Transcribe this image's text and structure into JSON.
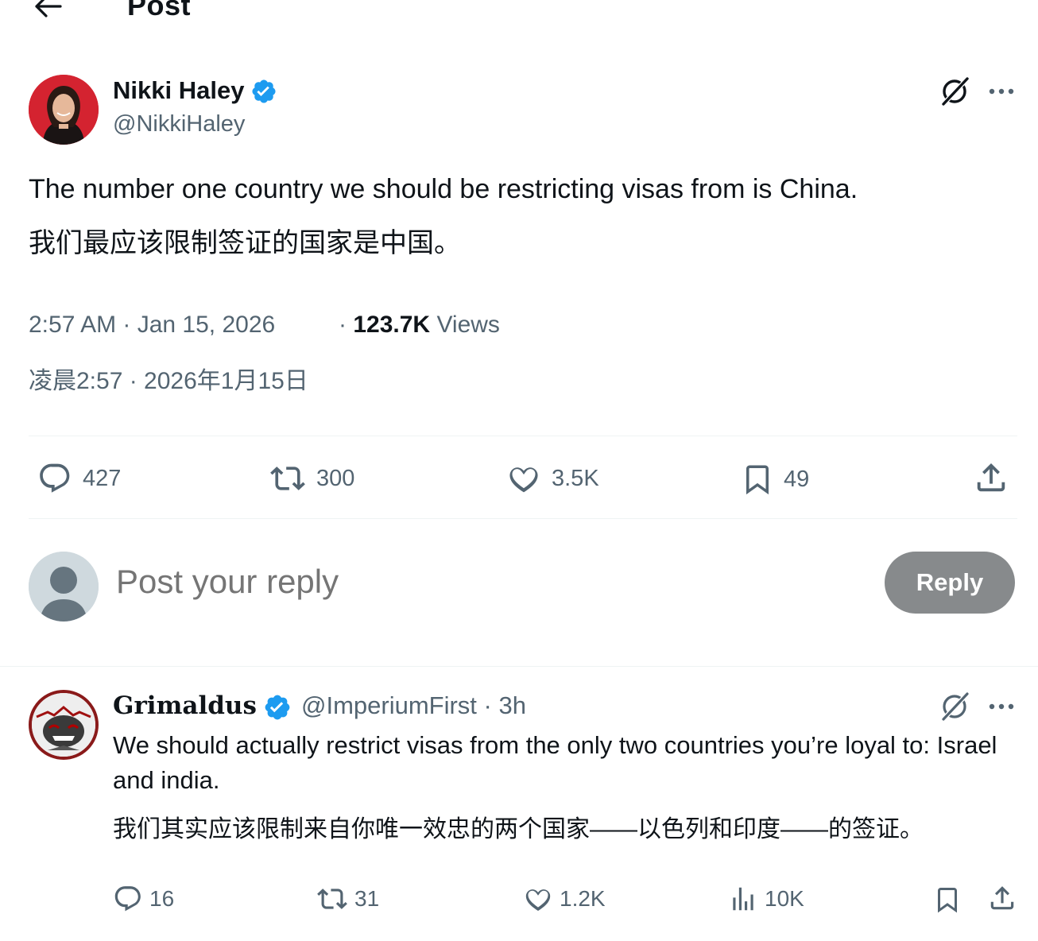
{
  "header": {
    "title": "Post"
  },
  "post": {
    "author_name": "Nikki Haley",
    "author_handle": "@NikkiHaley",
    "text_en": "The number one country we should be restricting visas from is China.",
    "text_zh": "我们最应该限制签证的国家是中国。",
    "timestamp": "2:57 AM · Jan 15, 2026",
    "views_sep": "·",
    "views_count": "123.7K",
    "views_label": "Views",
    "timestamp_zh": "凌晨2:57 · 2026年1月15日",
    "stats": {
      "replies": "427",
      "reposts": "300",
      "likes": "3.5K",
      "bookmarks": "49"
    }
  },
  "reply_composer": {
    "placeholder": "Post your reply",
    "button_label": "Reply"
  },
  "reply": {
    "author_name": "Grimaldus",
    "meta": "@ImperiumFirst · 3h",
    "text_en": "We should actually restrict visas from the only two countries you’re loyal to: Israel and india.",
    "text_zh": "我们其实应该限制来自你唯一效忠的两个国家——以色列和印度——的签证。",
    "stats": {
      "replies": "16",
      "reposts": "31",
      "likes": "1.2K",
      "views": "10K"
    }
  },
  "colors": {
    "verified": "#1d9bf0",
    "secondary_text": "#536471",
    "reply_button": "#878a8c"
  },
  "icons": [
    "back-arrow-icon",
    "verified-badge-icon",
    "grok-icon",
    "more-icon",
    "reply-icon",
    "repost-icon",
    "like-icon",
    "bookmark-icon",
    "share-icon",
    "views-icon"
  ]
}
